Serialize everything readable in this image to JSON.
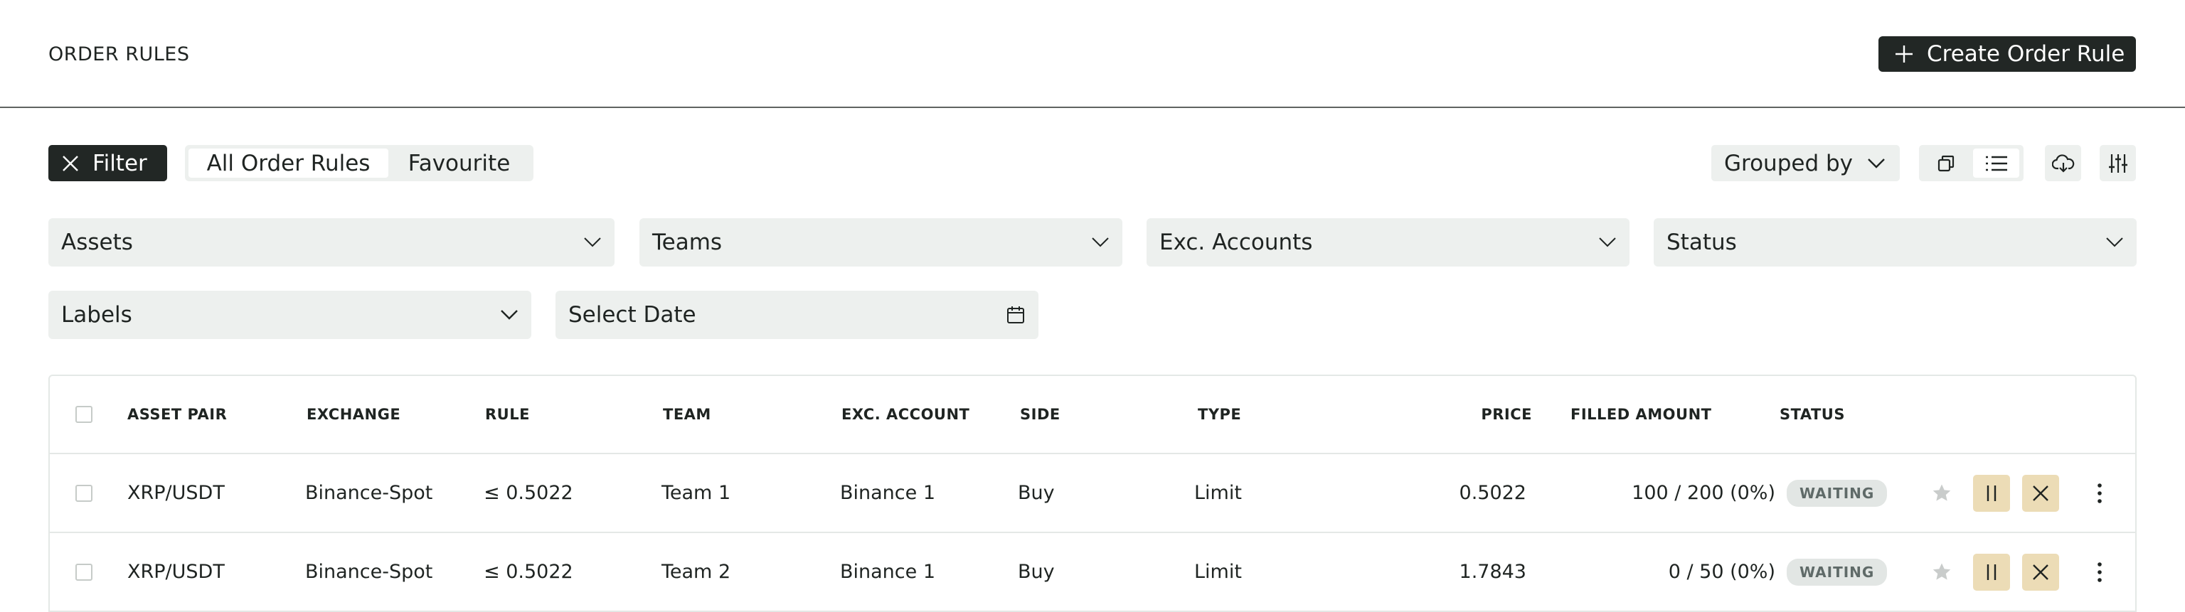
{
  "header": {
    "title": "ORDER RULES",
    "create_label": "Create Order Rule"
  },
  "toolbar": {
    "filter_label": "Filter",
    "tabs": [
      {
        "label": "All Order Rules",
        "active": true
      },
      {
        "label": "Favourite",
        "active": false
      }
    ],
    "grouped_label": "Grouped by",
    "view_modes": [
      "cards-icon",
      "list-icon"
    ],
    "active_view": "list-icon"
  },
  "filters": {
    "assets": "Assets",
    "teams": "Teams",
    "exc_accounts": "Exc. Accounts",
    "status": "Status",
    "labels": "Labels",
    "date_placeholder": "Select Date"
  },
  "table": {
    "columns": [
      "ASSET PAIR",
      "EXCHANGE",
      "RULE",
      "TEAM",
      "EXC. ACCOUNT",
      "SIDE",
      "TYPE",
      "PRICE",
      "FILLED AMOUNT",
      "STATUS"
    ],
    "rows": [
      {
        "asset_pair": "XRP/USDT",
        "exchange": "Binance-Spot",
        "rule": "≤ 0.5022",
        "team": "Team 1",
        "account": "Binance 1",
        "side": "Buy",
        "type": "Limit",
        "price": "0.5022",
        "filled": "100 / 200 (0%)",
        "status": "WAITING"
      },
      {
        "asset_pair": "XRP/USDT",
        "exchange": "Binance-Spot",
        "rule": "≤ 0.5022",
        "team": "Team 2",
        "account": "Binance 1",
        "side": "Buy",
        "type": "Limit",
        "price": "1.7843",
        "filled": "0 / 50 (0%)",
        "status": "WAITING"
      }
    ]
  },
  "colors": {
    "dark": "#222725",
    "surface": "#edf0ee",
    "action": "#ecdcb6",
    "badge": "#e2e6e4"
  }
}
